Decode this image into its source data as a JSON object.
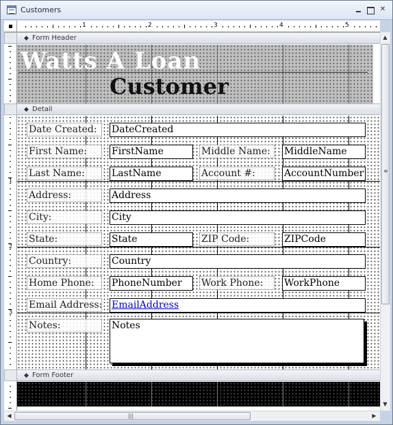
{
  "window": {
    "title": "Customers",
    "icons": {
      "app": "form-icon",
      "minimize": "minimize-icon",
      "maximize": "maximize-icon",
      "close": "close-icon"
    }
  },
  "ruler": {
    "horizontal_numbers": [
      "1",
      "2",
      "3",
      "4",
      "5"
    ],
    "vertical_numbers": [
      "1",
      "2",
      "3"
    ]
  },
  "sections": {
    "header": "Form Header",
    "detail": "Detail",
    "footer": "Form Footer"
  },
  "header": {
    "brand": "Watts A Loan",
    "title": "Customer"
  },
  "labels": {
    "date_created": "Date Created:",
    "first_name": "First Name:",
    "middle_name": "Middle Name:",
    "last_name": "Last Name:",
    "account": "Account #:",
    "address": "Address:",
    "city": "City:",
    "state": "State:",
    "zip": "ZIP Code:",
    "country": "Country:",
    "home_phone": "Home Phone:",
    "work_phone": "Work Phone:",
    "email": "Email Address:",
    "notes": "Notes:"
  },
  "fields": {
    "date_created": "DateCreated",
    "first_name": "FirstName",
    "middle_name": "MiddleName",
    "last_name": "LastName",
    "account": "AccountNumber",
    "address": "Address",
    "city": "City",
    "state": "State",
    "zip": "ZIPCode",
    "country": "Country",
    "home_phone": "PhoneNumber",
    "work_phone": "WorkPhone",
    "email": "EmailAddress",
    "notes": "Notes"
  },
  "colors": {
    "header_background": "#bfbfbf",
    "footer_background": "#000000",
    "link": "#0000cc"
  }
}
